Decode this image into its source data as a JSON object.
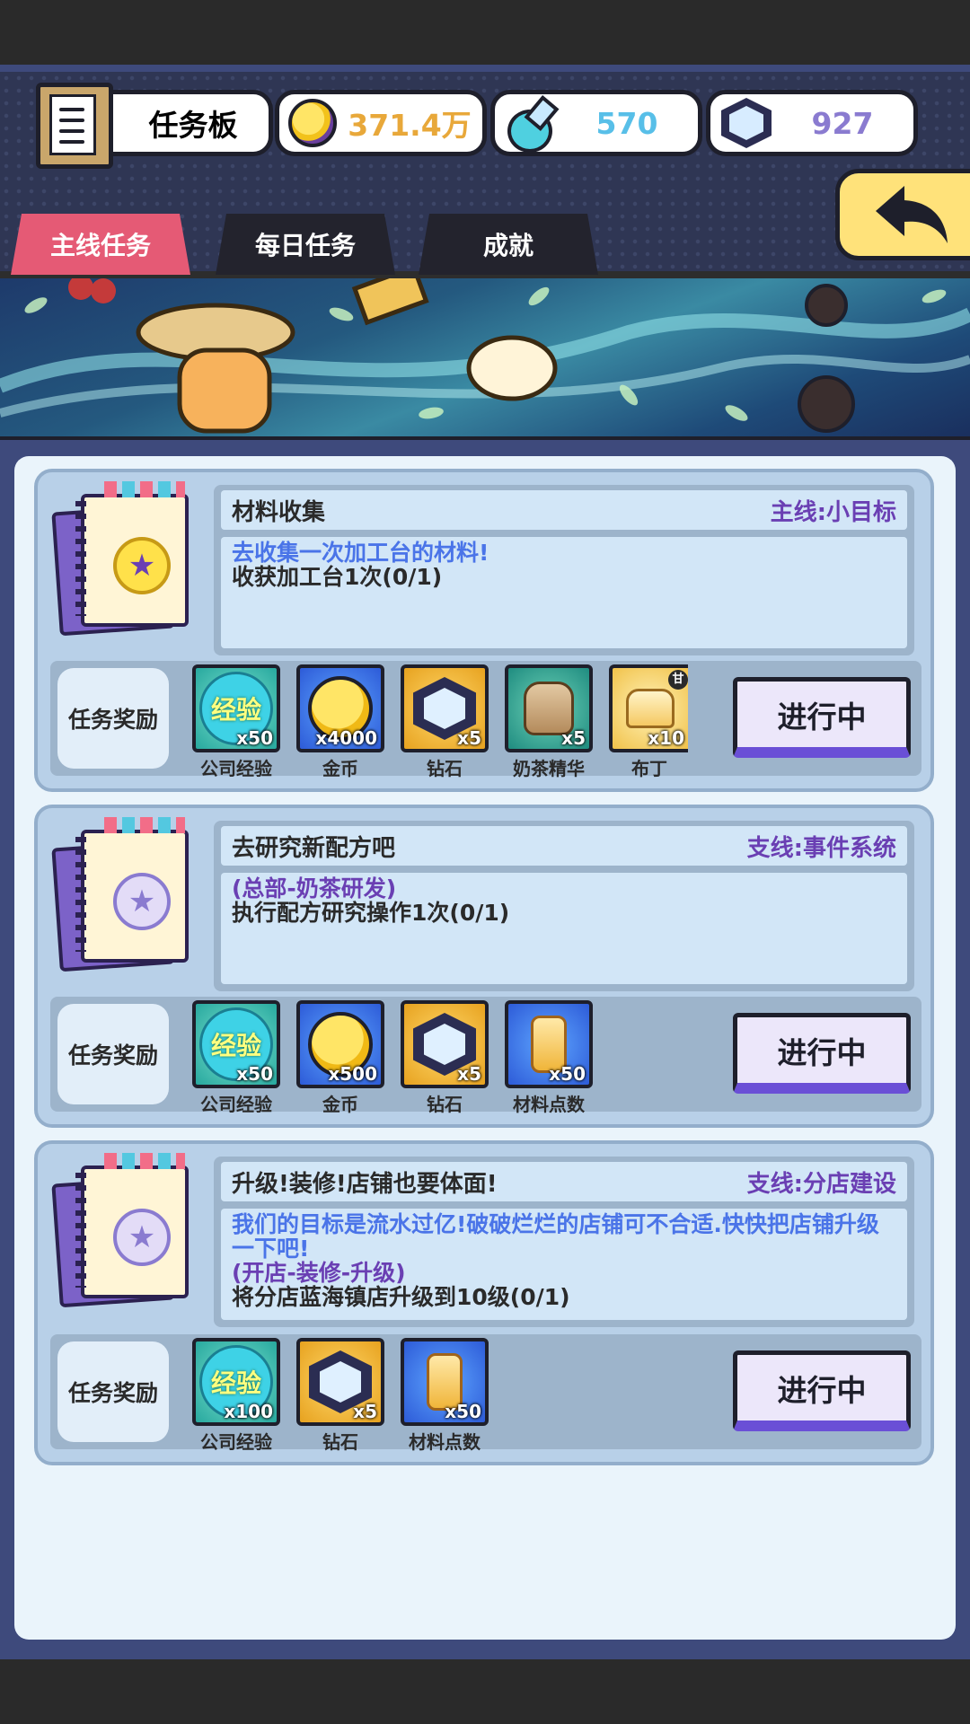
{
  "header": {
    "title": "任务板",
    "coins": "371.4万",
    "potions": "570",
    "gems": "927"
  },
  "tabs": [
    {
      "label": "主线任务",
      "active": true
    },
    {
      "label": "每日任务",
      "active": false
    },
    {
      "label": "成就",
      "active": false
    }
  ],
  "colors": {
    "accent": "#e55a75",
    "frame": "#3e4a7c",
    "progress_bar": "#6a4fd6",
    "tag": "#6a3fb3"
  },
  "quests": [
    {
      "title": "材料收集",
      "tag": "主线:小目标",
      "lines": [
        {
          "style": "blue",
          "text": "去收集一次加工台的材料!"
        },
        {
          "style": "dark",
          "text": "收获加工台1次(0/1)"
        }
      ],
      "reward_label": "任务奖励",
      "rewards": [
        {
          "icon": "exp-icon",
          "name": "公司经验",
          "qty": "x50"
        },
        {
          "icon": "coin-icon",
          "name": "金币",
          "qty": "x4000"
        },
        {
          "icon": "gem-icon",
          "name": "钻石",
          "qty": "x5"
        },
        {
          "icon": "milk-tea-essence-icon",
          "name": "奶茶精华",
          "qty": "x5"
        },
        {
          "icon": "pudding-icon",
          "name": "布丁",
          "qty": "x10",
          "badge": "甘"
        }
      ],
      "status": "进行中"
    },
    {
      "title": "去研究新配方吧",
      "tag": "支线:事件系统",
      "lines": [
        {
          "style": "purple",
          "text": "(总部-奶茶研发)"
        },
        {
          "style": "dark",
          "text": "执行配方研究操作1次(0/1)"
        }
      ],
      "reward_label": "任务奖励",
      "rewards": [
        {
          "icon": "exp-icon",
          "name": "公司经验",
          "qty": "x50"
        },
        {
          "icon": "coin-icon",
          "name": "金币",
          "qty": "x500"
        },
        {
          "icon": "gem-icon",
          "name": "钻石",
          "qty": "x5"
        },
        {
          "icon": "material-points-icon",
          "name": "材料点数",
          "qty": "x50"
        }
      ],
      "status": "进行中"
    },
    {
      "title": "升级!装修!店铺也要体面!",
      "tag": "支线:分店建设",
      "lines": [
        {
          "style": "blue",
          "text": "我们的目标是流水过亿!破破烂烂的店铺可不合适.快快把店铺升级一下吧!"
        },
        {
          "style": "purple",
          "text": "(开店-装修-升级)"
        },
        {
          "style": "dark",
          "text": "将分店蓝海镇店升级到10级(0/1)"
        }
      ],
      "reward_label": "任务奖励",
      "rewards": [
        {
          "icon": "exp-icon",
          "name": "公司经验",
          "qty": "x100"
        },
        {
          "icon": "gem-icon",
          "name": "钻石",
          "qty": "x5"
        },
        {
          "icon": "material-points-icon",
          "name": "材料点数",
          "qty": "x50"
        }
      ],
      "status": "进行中"
    }
  ]
}
